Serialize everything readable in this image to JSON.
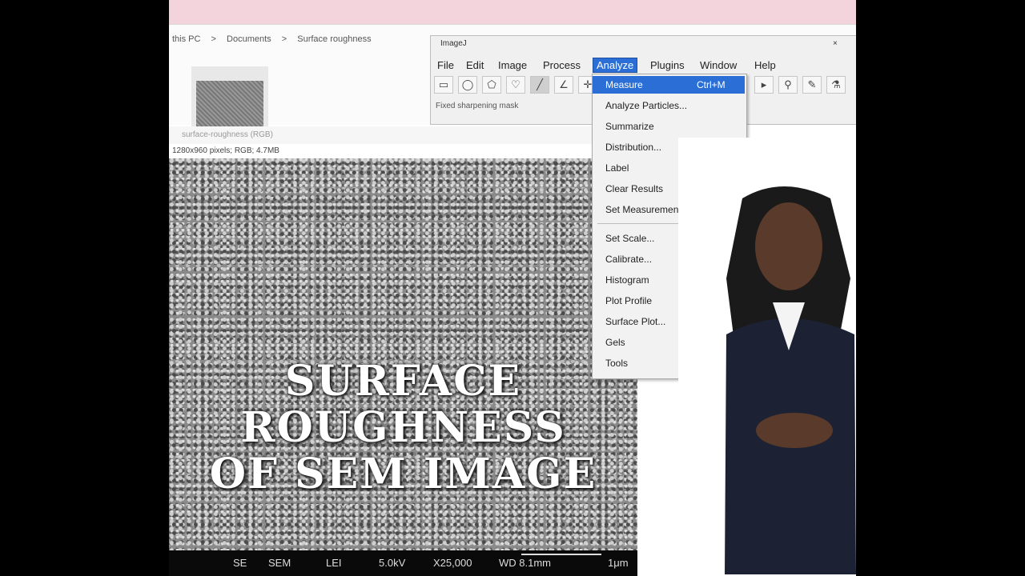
{
  "explorer": {
    "breadcrumb": [
      "this PC",
      ">",
      "Documents",
      ">",
      "Surface roughness"
    ]
  },
  "image_window": {
    "title": "surface-roughness (RGB)",
    "info": "1280x960 pixels; RGB; 4.7MB"
  },
  "imagej": {
    "title": "ImageJ",
    "close": "×",
    "menus": [
      "File",
      "Edit",
      "Image",
      "Process",
      "Analyze",
      "Plugins",
      "Window",
      "Help"
    ],
    "active_menu": "Analyze",
    "status": "Fixed sharpening mask"
  },
  "analyze_menu": {
    "items": [
      {
        "label": "Measure",
        "shortcut": "Ctrl+M",
        "highlighted": true
      },
      {
        "label": "Analyze Particles...",
        "shortcut": ""
      },
      {
        "label": "Summarize",
        "shortcut": ""
      },
      {
        "label": "Distribution...",
        "shortcut": ""
      },
      {
        "label": "Label",
        "shortcut": ""
      },
      {
        "label": "Clear Results",
        "shortcut": ""
      },
      {
        "label": "Set Measurements...",
        "shortcut": ""
      },
      {
        "label": "Set Scale...",
        "shortcut": ""
      },
      {
        "label": "Calibrate...",
        "shortcut": ""
      },
      {
        "label": "Histogram",
        "shortcut": ""
      },
      {
        "label": "Plot Profile",
        "shortcut": ""
      },
      {
        "label": "Surface Plot...",
        "shortcut": ""
      },
      {
        "label": "Gels",
        "shortcut": ""
      },
      {
        "label": "Tools",
        "shortcut": ""
      }
    ]
  },
  "sem_databar": {
    "fields": [
      "SE",
      "SEM",
      "LEI",
      "5.0kV",
      "X25,000",
      "WD 8.1mm",
      "1μm"
    ]
  },
  "overlay": {
    "line1": "SURFACE",
    "line2": "ROUGHNESS",
    "line3": "OF SEM IMAGE"
  },
  "colors": {
    "menu_highlight": "#2b6fd6",
    "pink_bar": "#f3d3dc",
    "overlay_text": "#ffffff"
  }
}
